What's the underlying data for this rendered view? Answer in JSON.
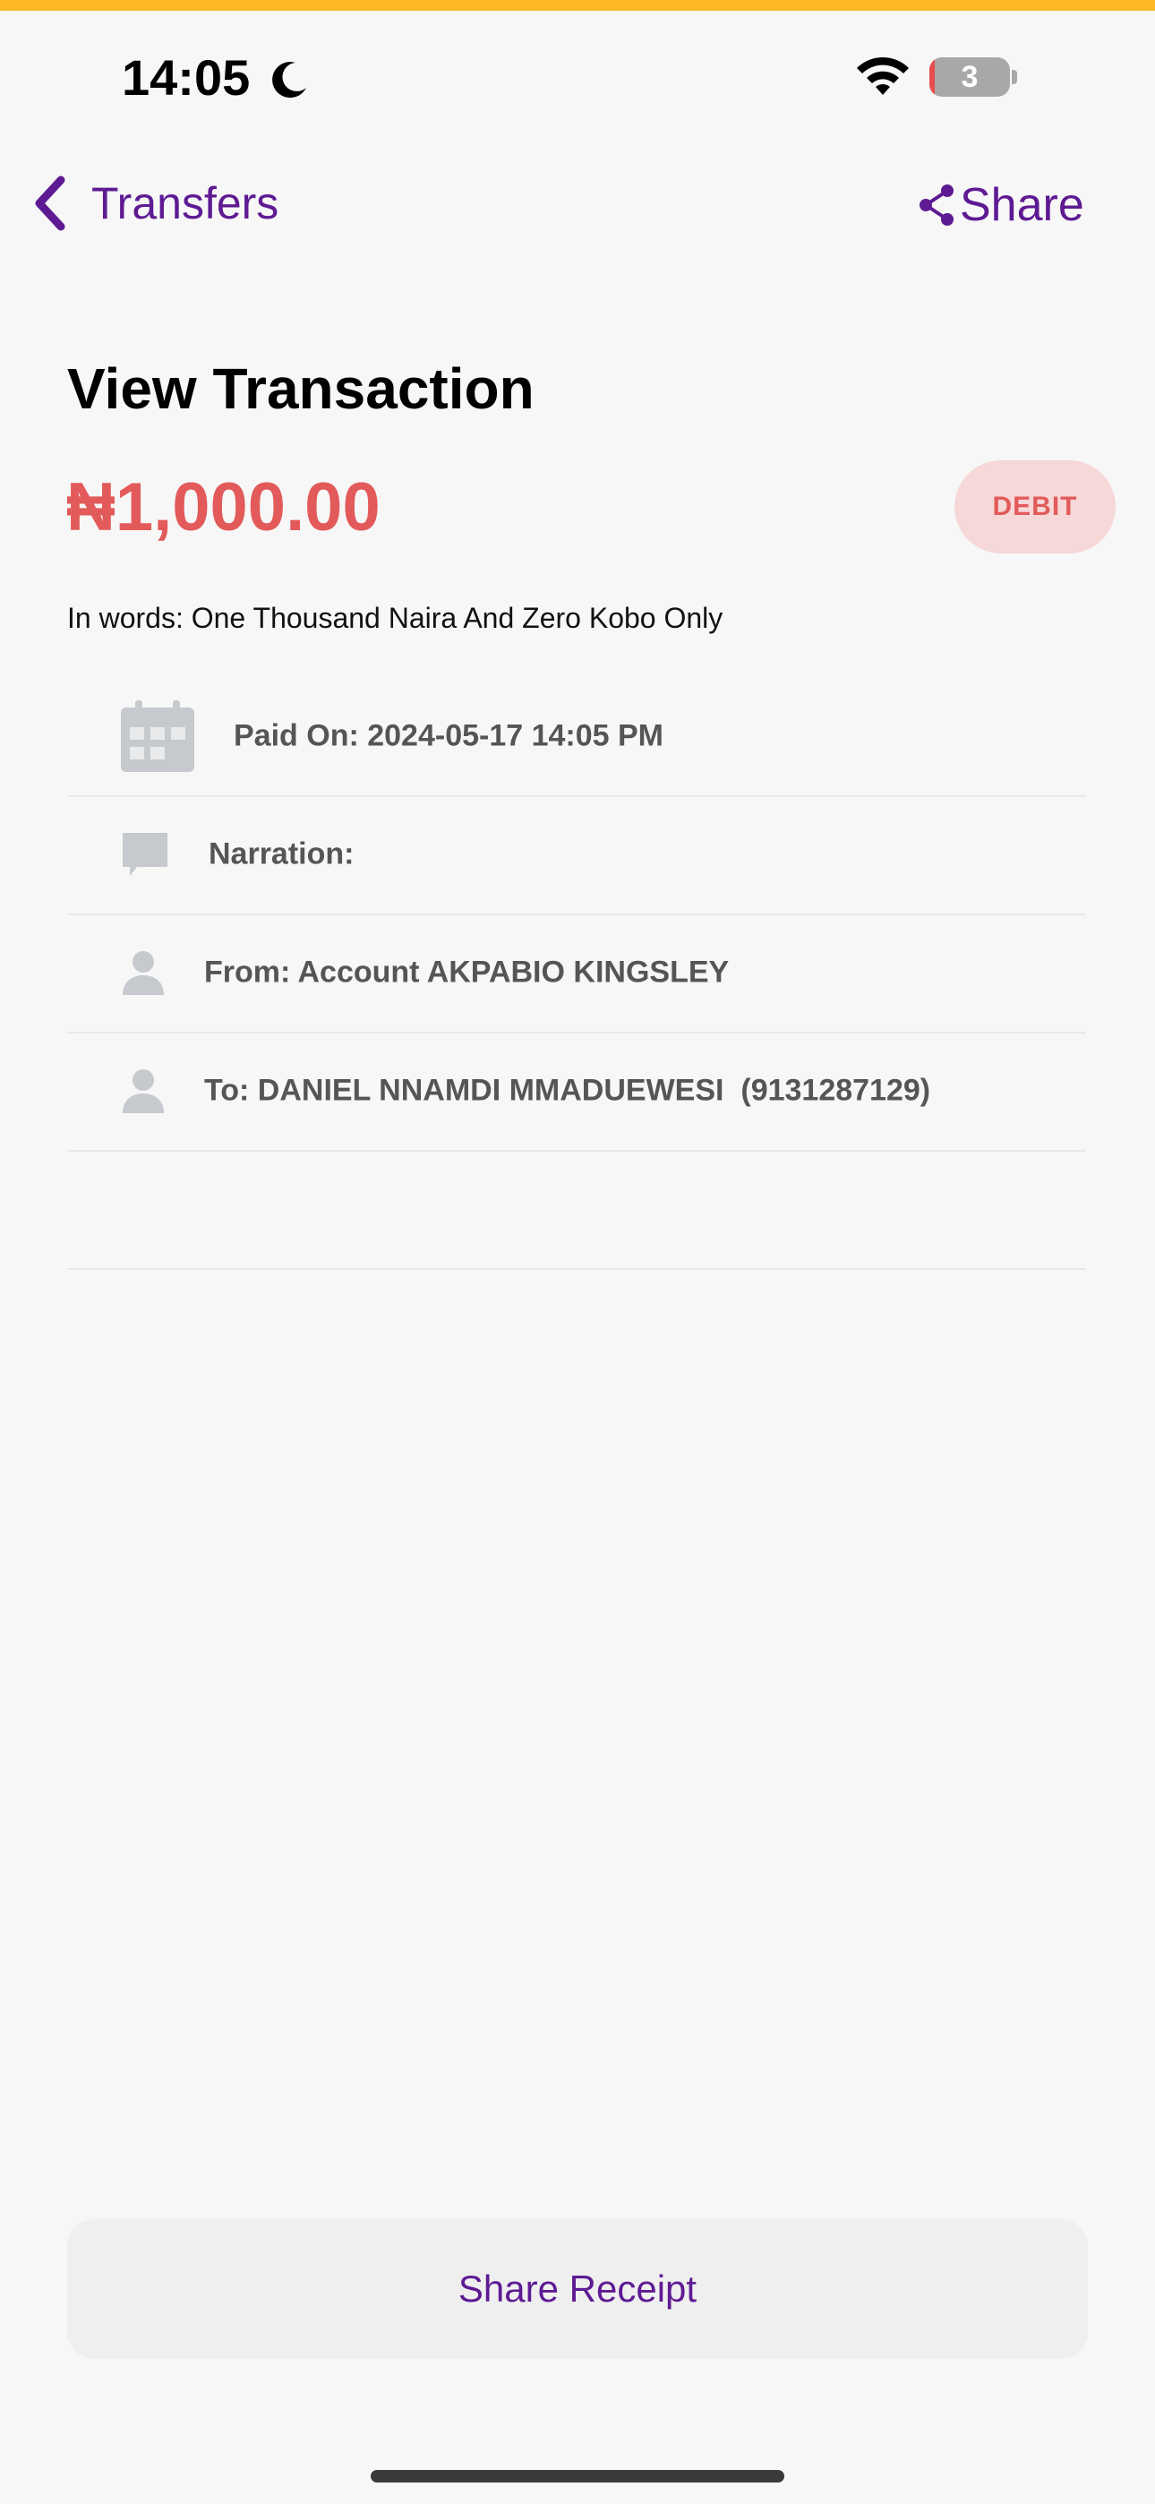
{
  "status_bar": {
    "time": "14:05",
    "battery_level": "3"
  },
  "nav": {
    "back_label": "Transfers",
    "share_label": "Share"
  },
  "title": "View Transaction",
  "amount": "₦1,000.00",
  "type_badge": "DEBIT",
  "in_words": "In words: One Thousand Naira And Zero Kobo Only",
  "details": {
    "paid_on": "Paid On: 2024-05-17 14:05 PM",
    "narration": "Narration:",
    "from": "From: Account AKPABIO KINGSLEY",
    "to": "To: DANIEL NNAMDI MMADUEWESI  (9131287129)"
  },
  "icons": {
    "paid_on": "calendar-icon",
    "narration": "chat-bubble-icon",
    "from": "person-icon",
    "to": "person-icon"
  },
  "share_receipt_label": "Share Receipt",
  "colors": {
    "accent": "#5e1a93",
    "debit": "#e35a5a",
    "debit_bg": "#f6d8d8",
    "top_stripe": "#fbb822",
    "icon_gray": "#c6c9cd"
  }
}
